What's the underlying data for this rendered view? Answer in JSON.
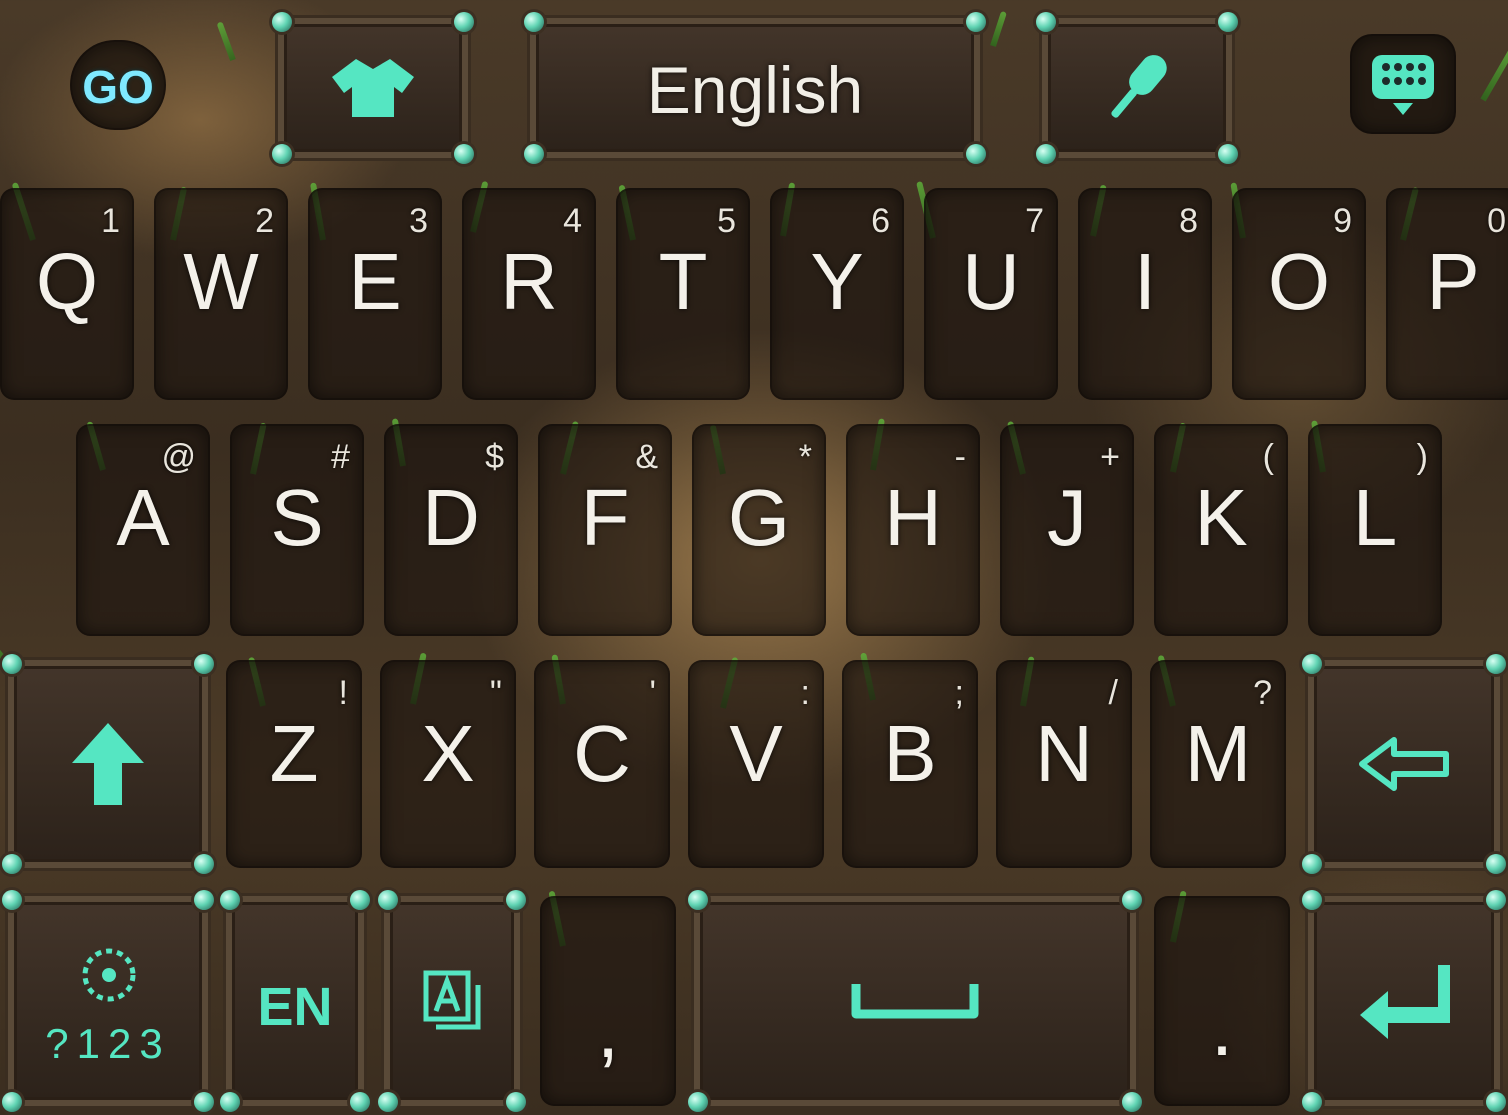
{
  "topbar": {
    "go_label": "GO",
    "language_label": "English"
  },
  "rows": {
    "row1": [
      {
        "key": "Q",
        "hint": "1"
      },
      {
        "key": "W",
        "hint": "2"
      },
      {
        "key": "E",
        "hint": "3"
      },
      {
        "key": "R",
        "hint": "4"
      },
      {
        "key": "T",
        "hint": "5"
      },
      {
        "key": "Y",
        "hint": "6"
      },
      {
        "key": "U",
        "hint": "7"
      },
      {
        "key": "I",
        "hint": "8"
      },
      {
        "key": "O",
        "hint": "9"
      },
      {
        "key": "P",
        "hint": "0"
      }
    ],
    "row2": [
      {
        "key": "A",
        "hint": "@"
      },
      {
        "key": "S",
        "hint": "#"
      },
      {
        "key": "D",
        "hint": "$"
      },
      {
        "key": "F",
        "hint": "&"
      },
      {
        "key": "G",
        "hint": "*"
      },
      {
        "key": "H",
        "hint": "-"
      },
      {
        "key": "J",
        "hint": "+"
      },
      {
        "key": "K",
        "hint": "("
      },
      {
        "key": "L",
        "hint": ")"
      }
    ],
    "row3": [
      {
        "key": "Z",
        "hint": "!"
      },
      {
        "key": "X",
        "hint": "\""
      },
      {
        "key": "C",
        "hint": "'"
      },
      {
        "key": "V",
        "hint": ":"
      },
      {
        "key": "B",
        "hint": ";"
      },
      {
        "key": "N",
        "hint": "/"
      },
      {
        "key": "M",
        "hint": "?"
      }
    ]
  },
  "bottom": {
    "symbols_label": "?123",
    "lang_label": "EN",
    "comma": ",",
    "period": "."
  },
  "colors": {
    "accent": "#55e6c2",
    "key_text": "#f4f1ea",
    "frame": "#5a4a38"
  },
  "icons": {
    "theme": "shirt-icon",
    "mic": "microphone-icon",
    "keypad": "keypad-icon",
    "shift": "shift-arrow-icon",
    "backspace": "backspace-arrow-icon",
    "settings": "settings-gear-icon",
    "text_mode": "text-box-icon",
    "space": "spacebar-icon",
    "enter": "enter-arrow-icon"
  }
}
